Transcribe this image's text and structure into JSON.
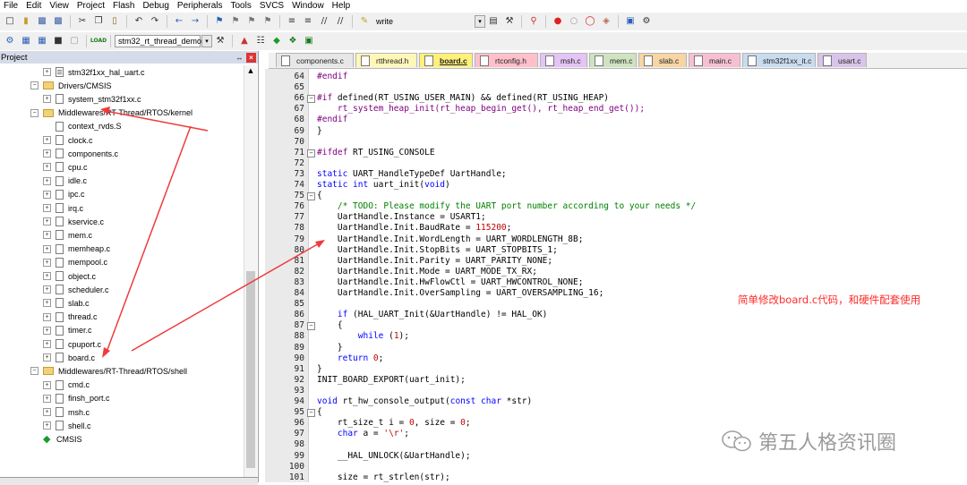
{
  "menu": [
    "File",
    "Edit",
    "View",
    "Project",
    "Flash",
    "Debug",
    "Peripherals",
    "Tools",
    "SVCS",
    "Window",
    "Help"
  ],
  "toolbar1": {
    "find_value": "write"
  },
  "toolbar2": {
    "target_value": "stm32_rt_thread_demo",
    "load_label": "LOAD"
  },
  "project_panel": {
    "title": "Project",
    "pin_glyph": "↔",
    "close_glyph": "×",
    "tree": [
      {
        "label": "stm32f1xx_hal_uart.c",
        "type": "file",
        "indent": 48,
        "exp": "+"
      },
      {
        "label": "Drivers/CMSIS",
        "type": "folder",
        "indent": 34,
        "exp": "−"
      },
      {
        "label": "system_stm32f1xx.c",
        "type": "file",
        "indent": 48,
        "exp": "+"
      },
      {
        "label": "Middlewares/RT-Thread/RTOS/kernel",
        "type": "folder",
        "indent": 34,
        "exp": "−"
      },
      {
        "label": "context_rvds.S",
        "type": "file",
        "indent": 48,
        "exp": ""
      },
      {
        "label": "clock.c",
        "type": "file",
        "indent": 48,
        "exp": "+"
      },
      {
        "label": "components.c",
        "type": "file",
        "indent": 48,
        "exp": "+"
      },
      {
        "label": "cpu.c",
        "type": "file",
        "indent": 48,
        "exp": "+"
      },
      {
        "label": "idle.c",
        "type": "file",
        "indent": 48,
        "exp": "+"
      },
      {
        "label": "ipc.c",
        "type": "file",
        "indent": 48,
        "exp": "+"
      },
      {
        "label": "irq.c",
        "type": "file",
        "indent": 48,
        "exp": "+"
      },
      {
        "label": "kservice.c",
        "type": "file",
        "indent": 48,
        "exp": "+"
      },
      {
        "label": "mem.c",
        "type": "file",
        "indent": 48,
        "exp": "+"
      },
      {
        "label": "memheap.c",
        "type": "file",
        "indent": 48,
        "exp": "+"
      },
      {
        "label": "mempool.c",
        "type": "file",
        "indent": 48,
        "exp": "+"
      },
      {
        "label": "object.c",
        "type": "file",
        "indent": 48,
        "exp": "+"
      },
      {
        "label": "scheduler.c",
        "type": "file",
        "indent": 48,
        "exp": "+"
      },
      {
        "label": "slab.c",
        "type": "file",
        "indent": 48,
        "exp": "+"
      },
      {
        "label": "thread.c",
        "type": "file",
        "indent": 48,
        "exp": "+"
      },
      {
        "label": "timer.c",
        "type": "file",
        "indent": 48,
        "exp": "+"
      },
      {
        "label": "cpuport.c",
        "type": "file",
        "indent": 48,
        "exp": "+"
      },
      {
        "label": "board.c",
        "type": "file",
        "indent": 48,
        "exp": "+"
      },
      {
        "label": "Middlewares/RT-Thread/RTOS/shell",
        "type": "folder",
        "indent": 34,
        "exp": "−"
      },
      {
        "label": "cmd.c",
        "type": "file",
        "indent": 48,
        "exp": "+"
      },
      {
        "label": "finsh_port.c",
        "type": "file",
        "indent": 48,
        "exp": "+"
      },
      {
        "label": "msh.c",
        "type": "file",
        "indent": 48,
        "exp": "+"
      },
      {
        "label": "shell.c",
        "type": "file",
        "indent": 48,
        "exp": "+"
      },
      {
        "label": "CMSIS",
        "type": "cmsis",
        "indent": 34,
        "exp": ""
      }
    ]
  },
  "editor_tabs": [
    {
      "label": "components.c",
      "color": "#e7e7e7",
      "active": false
    },
    {
      "label": "rtthread.h",
      "color": "#fff7b8",
      "active": false
    },
    {
      "label": "board.c",
      "color": "#fff07a",
      "active": true
    },
    {
      "label": "rtconfig.h",
      "color": "#ffc0cb",
      "active": false
    },
    {
      "label": "msh.c",
      "color": "#e3c4f4",
      "active": false
    },
    {
      "label": "mem.c",
      "color": "#cfe3c1",
      "active": false
    },
    {
      "label": "slab.c",
      "color": "#f8d5a5",
      "active": false
    },
    {
      "label": "main.c",
      "color": "#f7c0d2",
      "active": false
    },
    {
      "label": "stm32f1xx_it.c",
      "color": "#c9dcef",
      "active": false
    },
    {
      "label": "usart.c",
      "color": "#d9c4e9",
      "active": false
    }
  ],
  "code": [
    {
      "n": "64",
      "fold": "",
      "t": [
        [
          "pp",
          "#endif"
        ]
      ]
    },
    {
      "n": "65",
      "fold": "",
      "t": []
    },
    {
      "n": "66",
      "fold": "−",
      "t": [
        [
          "pp",
          "#if "
        ],
        [
          "",
          "defined(RT_USING_USER_MAIN) && defined(RT_USING_HEAP)"
        ]
      ]
    },
    {
      "n": "67",
      "fold": "",
      "t": [
        [
          "pp",
          "    rt_system_heap_init(rt_heap_begin_get(), rt_heap_end_get());"
        ]
      ]
    },
    {
      "n": "68",
      "fold": "",
      "t": [
        [
          "pp",
          "#endif"
        ]
      ]
    },
    {
      "n": "69",
      "fold": "",
      "t": [
        [
          "",
          "}"
        ]
      ]
    },
    {
      "n": "70",
      "fold": "",
      "t": []
    },
    {
      "n": "71",
      "fold": "−",
      "t": [
        [
          "pp",
          "#ifdef "
        ],
        [
          "",
          "RT_USING_CONSOLE"
        ]
      ]
    },
    {
      "n": "72",
      "fold": "",
      "t": []
    },
    {
      "n": "73",
      "fold": "",
      "t": [
        [
          "kw",
          "static "
        ],
        [
          "",
          "UART_HandleTypeDef UartHandle;"
        ]
      ]
    },
    {
      "n": "74",
      "fold": "",
      "t": [
        [
          "kw",
          "static int "
        ],
        [
          "",
          "uart_init("
        ],
        [
          "kw",
          "void"
        ],
        [
          "",
          ")"
        ]
      ]
    },
    {
      "n": "75",
      "fold": "−",
      "t": [
        [
          "",
          "{"
        ]
      ]
    },
    {
      "n": "76",
      "fold": "",
      "t": [
        [
          "cm",
          "    /* TODO: Please modify the UART port number according to your needs */"
        ]
      ]
    },
    {
      "n": "77",
      "fold": "",
      "t": [
        [
          "",
          "    UartHandle.Instance = USART1;"
        ]
      ]
    },
    {
      "n": "78",
      "fold": "",
      "t": [
        [
          "",
          "    UartHandle.Init.BaudRate = "
        ],
        [
          "nm",
          "115200"
        ],
        [
          "",
          ";"
        ]
      ]
    },
    {
      "n": "79",
      "fold": "",
      "t": [
        [
          "",
          "    UartHandle.Init.WordLength = UART_WORDLENGTH_8B;"
        ]
      ]
    },
    {
      "n": "80",
      "fold": "",
      "t": [
        [
          "",
          "    UartHandle.Init.StopBits = UART_STOPBITS_1;"
        ]
      ]
    },
    {
      "n": "81",
      "fold": "",
      "t": [
        [
          "",
          "    UartHandle.Init.Parity = UART_PARITY_NONE;"
        ]
      ]
    },
    {
      "n": "82",
      "fold": "",
      "t": [
        [
          "",
          "    UartHandle.Init.Mode = UART_MODE_TX_RX;"
        ]
      ]
    },
    {
      "n": "83",
      "fold": "",
      "t": [
        [
          "",
          "    UartHandle.Init.HwFlowCtl = UART_HWCONTROL_NONE;"
        ]
      ]
    },
    {
      "n": "84",
      "fold": "",
      "t": [
        [
          "",
          "    UartHandle.Init.OverSampling = UART_OVERSAMPLING_16;"
        ]
      ]
    },
    {
      "n": "85",
      "fold": "",
      "t": []
    },
    {
      "n": "86",
      "fold": "",
      "t": [
        [
          "kw",
          "    if "
        ],
        [
          "",
          "(HAL_UART_Init(&UartHandle) != HAL_OK)"
        ]
      ]
    },
    {
      "n": "87",
      "fold": "−",
      "t": [
        [
          "",
          "    {"
        ]
      ]
    },
    {
      "n": "88",
      "fold": "",
      "t": [
        [
          "kw",
          "        while "
        ],
        [
          "",
          "("
        ],
        [
          "nm",
          "1"
        ],
        [
          "",
          ");"
        ]
      ]
    },
    {
      "n": "89",
      "fold": "",
      "t": [
        [
          "",
          "    }"
        ]
      ]
    },
    {
      "n": "90",
      "fold": "",
      "t": [
        [
          "kw",
          "    return "
        ],
        [
          "nm",
          "0"
        ],
        [
          "",
          ";"
        ]
      ]
    },
    {
      "n": "91",
      "fold": "",
      "t": [
        [
          "",
          "}"
        ]
      ]
    },
    {
      "n": "92",
      "fold": "",
      "t": [
        [
          "",
          "INIT_BOARD_EXPORT(uart_init);"
        ]
      ]
    },
    {
      "n": "93",
      "fold": "",
      "t": []
    },
    {
      "n": "94",
      "fold": "",
      "t": [
        [
          "kw",
          "void "
        ],
        [
          "",
          "rt_hw_console_output("
        ],
        [
          "kw",
          "const char "
        ],
        [
          "",
          "*str)"
        ]
      ]
    },
    {
      "n": "95",
      "fold": "−",
      "t": [
        [
          "",
          "{"
        ]
      ]
    },
    {
      "n": "96",
      "fold": "",
      "t": [
        [
          "",
          "    rt_size_t i = "
        ],
        [
          "nm",
          "0"
        ],
        [
          "",
          ", size = "
        ],
        [
          "nm",
          "0"
        ],
        [
          "",
          ";"
        ]
      ]
    },
    {
      "n": "97",
      "fold": "",
      "t": [
        [
          "kw",
          "    char "
        ],
        [
          "",
          "a = "
        ],
        [
          "nm",
          "'\\r'"
        ],
        [
          "",
          ";"
        ]
      ]
    },
    {
      "n": "98",
      "fold": "",
      "t": []
    },
    {
      "n": "99",
      "fold": "",
      "t": [
        [
          "",
          "    __HAL_UNLOCK(&UartHandle);"
        ]
      ]
    },
    {
      "n": "100",
      "fold": "",
      "t": []
    },
    {
      "n": "101",
      "fold": "",
      "t": [
        [
          "",
          "    size = rt_strlen(str);"
        ]
      ]
    }
  ],
  "annotation": {
    "text": "简单修改board.c代码，和硬件配套使用"
  },
  "watermark": {
    "text": "第五人格资讯圈"
  }
}
